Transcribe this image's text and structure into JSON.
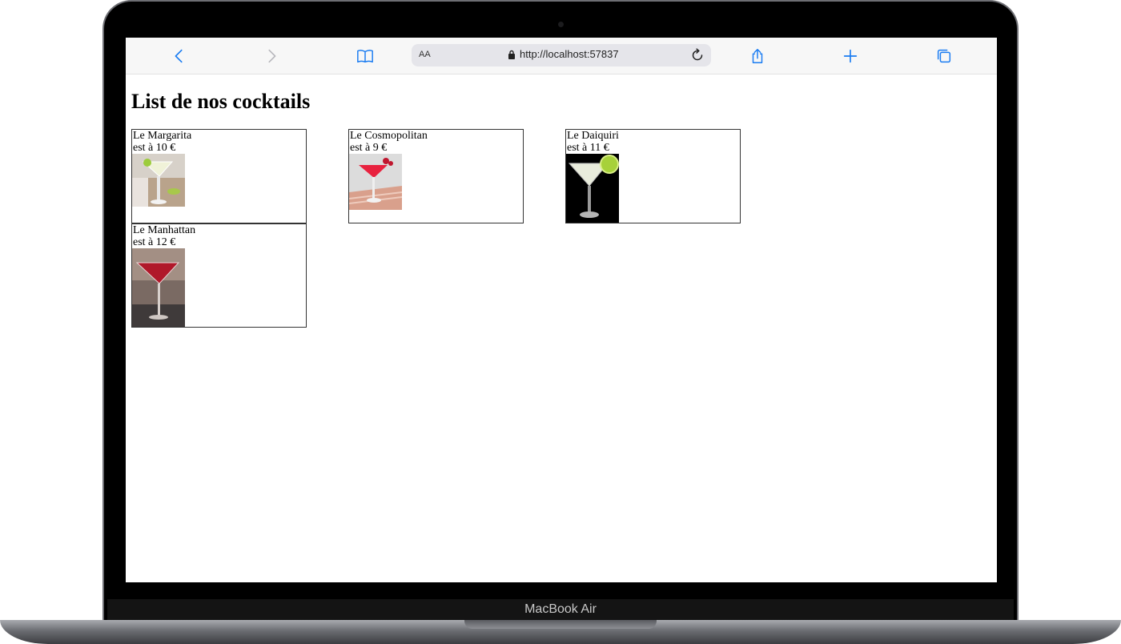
{
  "browser": {
    "address_prefix": "AA",
    "url": "http://localhost:57837"
  },
  "device": {
    "label": "MacBook Air"
  },
  "page": {
    "title": "List de nos cocktails",
    "cocktails": [
      {
        "name": "Le Margarita",
        "price": "est à 10 €"
      },
      {
        "name": "Le Cosmopolitan",
        "price": "est à 9 €"
      },
      {
        "name": "Le Daiquiri",
        "price": "est à 11 €"
      },
      {
        "name": "Le Manhattan",
        "price": "est à 12 €"
      }
    ]
  },
  "colors": {
    "accent": "#1a7cf2",
    "frame": "#000000"
  },
  "icons": [
    "chevron-left-icon",
    "chevron-right-icon",
    "book-icon",
    "lock-icon",
    "reload-icon",
    "share-icon",
    "plus-icon",
    "tabs-icon"
  ]
}
